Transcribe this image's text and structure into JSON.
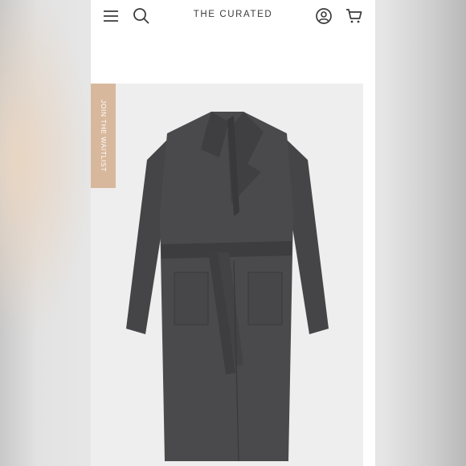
{
  "header": {
    "brand": "THE CURATED",
    "icons": {
      "menu": "menu-icon",
      "search": "search-icon",
      "account": "account-icon",
      "cart": "cart-icon"
    }
  },
  "waitlist_tab": {
    "label": "JOIN THE WAITLIST"
  },
  "colors": {
    "accent": "#d8b89c",
    "coat": "#4a4a4c",
    "product_bg": "#eeeeee"
  }
}
